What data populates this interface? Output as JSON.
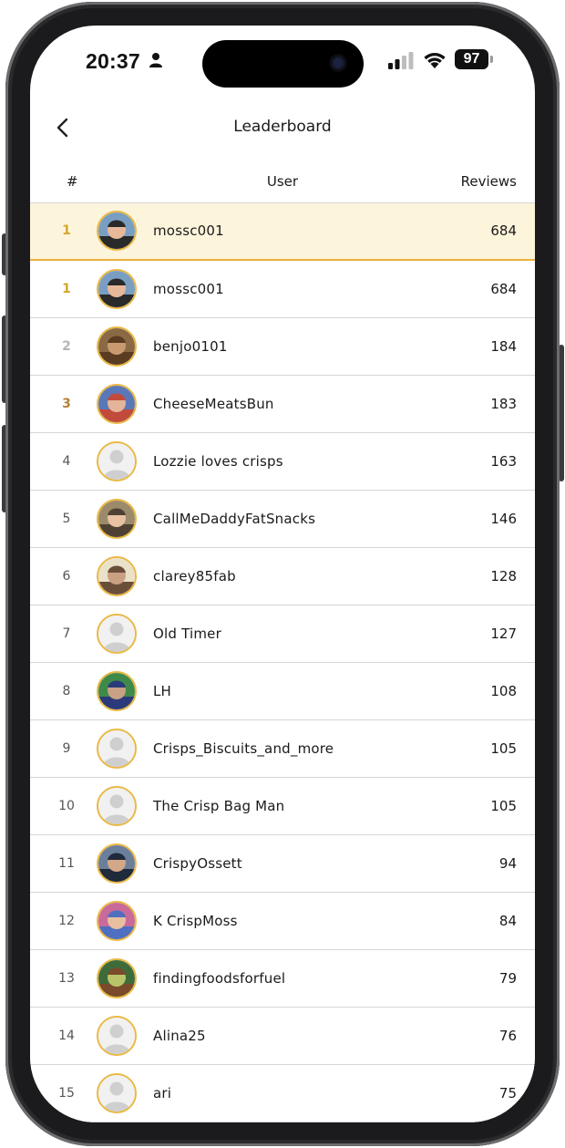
{
  "status_bar": {
    "time": "20:37",
    "battery": "97",
    "icons": [
      "person-icon",
      "signal-icon",
      "wifi-icon",
      "battery-icon"
    ]
  },
  "nav": {
    "title": "Leaderboard",
    "back_icon": "chevron-left-icon"
  },
  "table": {
    "headers": {
      "rank": "#",
      "user": "User",
      "reviews": "Reviews"
    }
  },
  "current_user": {
    "rank": "1",
    "name": "mossc001",
    "reviews": "684",
    "rank_color": "#d4a72c"
  },
  "rows": [
    {
      "rank": "1",
      "name": "mossc001",
      "reviews": "684",
      "rank_color": "#d4a72c",
      "avatar": "photo"
    },
    {
      "rank": "2",
      "name": "benjo0101",
      "reviews": "184",
      "rank_color": "#b5b5b5",
      "avatar": "photo"
    },
    {
      "rank": "3",
      "name": "CheeseMeatsBun",
      "reviews": "183",
      "rank_color": "#b7813a",
      "avatar": "photo"
    },
    {
      "rank": "4",
      "name": "Lozzie loves crisps",
      "reviews": "163",
      "rank_color": "#555555",
      "avatar": "placeholder"
    },
    {
      "rank": "5",
      "name": "CallMeDaddyFatSnacks",
      "reviews": "146",
      "rank_color": "#555555",
      "avatar": "photo"
    },
    {
      "rank": "6",
      "name": "clarey85fab",
      "reviews": "128",
      "rank_color": "#555555",
      "avatar": "photo"
    },
    {
      "rank": "7",
      "name": "Old Timer",
      "reviews": "127",
      "rank_color": "#555555",
      "avatar": "placeholder"
    },
    {
      "rank": "8",
      "name": "LH",
      "reviews": "108",
      "rank_color": "#555555",
      "avatar": "photo"
    },
    {
      "rank": "9",
      "name": "Crisps_Biscuits_and_more",
      "reviews": "105",
      "rank_color": "#555555",
      "avatar": "placeholder"
    },
    {
      "rank": "10",
      "name": "The Crisp Bag Man",
      "reviews": "105",
      "rank_color": "#555555",
      "avatar": "placeholder"
    },
    {
      "rank": "11",
      "name": "CrispyOssett",
      "reviews": "94",
      "rank_color": "#555555",
      "avatar": "photo"
    },
    {
      "rank": "12",
      "name": "K CrispMoss",
      "reviews": "84",
      "rank_color": "#555555",
      "avatar": "photo"
    },
    {
      "rank": "13",
      "name": "findingfoodsforfuel",
      "reviews": "79",
      "rank_color": "#555555",
      "avatar": "photo"
    },
    {
      "rank": "14",
      "name": "Alina25",
      "reviews": "76",
      "rank_color": "#555555",
      "avatar": "placeholder"
    },
    {
      "rank": "15",
      "name": "ari",
      "reviews": "75",
      "rank_color": "#555555",
      "avatar": "placeholder"
    }
  ],
  "colors": {
    "accent": "#e9b843",
    "highlight_bg": "#fdf4dc",
    "gold": "#d4a72c",
    "silver": "#b5b5b5",
    "bronze": "#b7813a"
  }
}
